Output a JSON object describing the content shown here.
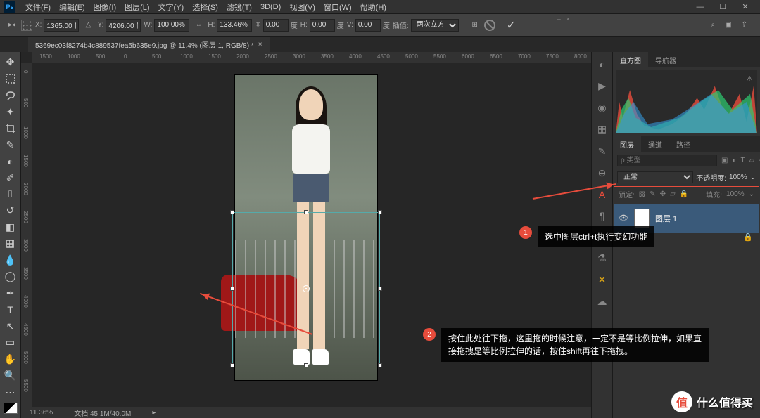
{
  "app": {
    "logo": "Ps"
  },
  "menu": {
    "items": [
      "文件(F)",
      "编辑(E)",
      "图像(I)",
      "图层(L)",
      "文字(Y)",
      "选择(S)",
      "滤镜(T)",
      "3D(D)",
      "视图(V)",
      "窗口(W)",
      "帮助(H)"
    ]
  },
  "options": {
    "x_label": "X:",
    "x_val": "1365.00 像",
    "y_label": "Y:",
    "y_val": "4206.00 像",
    "w_label": "W:",
    "w_val": "100.00%",
    "h_label": "H:",
    "h_val": "133.46%",
    "rot_label": "⇳",
    "rot_val": "0.00",
    "rot_unit": "度",
    "hsk_label": "H:",
    "hsk_val": "0.00",
    "hsk_unit": "度",
    "vsk_label": "V:",
    "vsk_val": "0.00",
    "vsk_unit": "度",
    "interp_label": "插值:",
    "interp_val": "两次立方"
  },
  "tab": {
    "title": "5369ec03f8274b4c889537fea5b635e9.jpg @ 11.4% (图层 1, RGB/8) *"
  },
  "ruler_h": [
    "1500",
    "1000",
    "500",
    "0",
    "500",
    "1000",
    "1500",
    "2000",
    "2500",
    "3000",
    "3500",
    "4000",
    "4500",
    "5000",
    "5500",
    "6000",
    "6500",
    "7000",
    "7500",
    "8000"
  ],
  "ruler_v": [
    "0",
    "500",
    "1000",
    "1500",
    "2000",
    "2500",
    "3000",
    "3500",
    "4000",
    "4500",
    "5000",
    "5500"
  ],
  "status": {
    "zoom": "11.36%",
    "doc": "文档:45.1M/40.0M"
  },
  "panels": {
    "hist_tabs": [
      "直方图",
      "导航器"
    ],
    "layer_tabs": [
      "图层",
      "通道",
      "路径"
    ],
    "kind_placeholder": "ρ 类型",
    "blend_mode": "正常",
    "opacity_label": "不透明度:",
    "opacity_val": "100%",
    "lock_label": "锁定:",
    "fill_label": "填充:",
    "fill_val": "100%",
    "layer1_name": "图层 1"
  },
  "annotations": {
    "a1": "选中图层ctrl+t执行变幻功能",
    "a2": "按住此处往下拖，这里拖的时候注意，一定不是等比例拉伸，如果直接拖拽是等比例拉伸的话，按住shift再往下拖拽。"
  },
  "watermark": {
    "icon": "值",
    "text": "什么值得买"
  }
}
